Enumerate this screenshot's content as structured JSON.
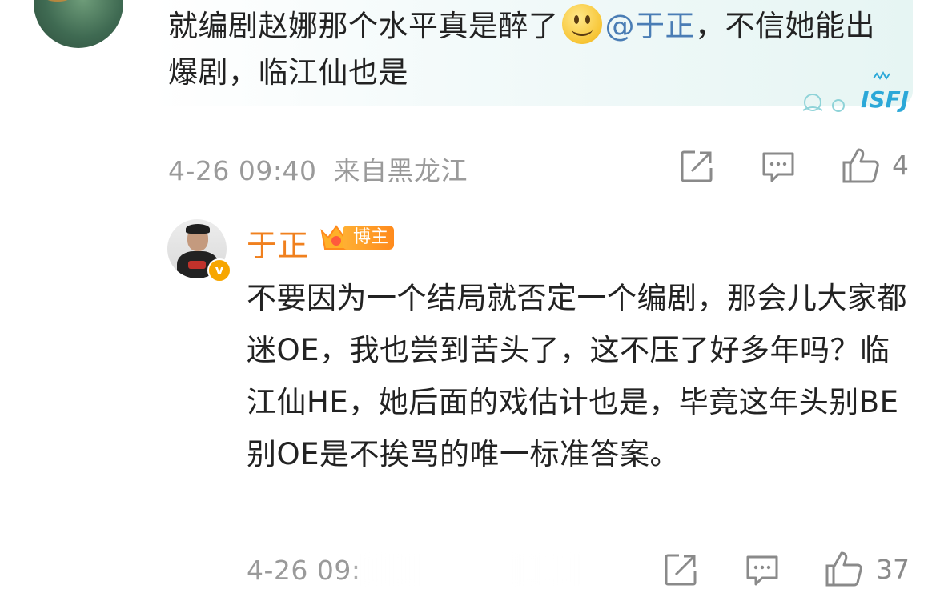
{
  "top_comment": {
    "text_before_emoji": "就编剧赵娜那个水平真是醉了",
    "emoji_name": "smile-emoji",
    "mention": "@于正",
    "text_after_mention": "，不信她能出爆剧，临江仙也是",
    "sticker_text": "ISFJ",
    "timestamp": "4-26 09:40",
    "location": "来自黑龙江",
    "like_count": "4"
  },
  "reply": {
    "username": "于正",
    "badge_label": "博主",
    "verified_icon": "v",
    "text": "不要因为一个结局就否定一个编剧，那会儿大家都迷OE，我也尝到苦头了，这不压了好多年吗？临江仙HE，她后面的戏估计也是，毕竟这年头别BE别OE是不挨骂的唯一标准答案。",
    "timestamp_partial": "4-26 09:",
    "like_count": "37"
  },
  "icons": {
    "share": "share-icon",
    "comment": "comment-icon",
    "like": "thumbs-up-icon"
  },
  "colors": {
    "username": "#f0801e",
    "mention": "#4a7db5",
    "meta": "#9a9a9a",
    "badge": "#ff8a1c"
  }
}
